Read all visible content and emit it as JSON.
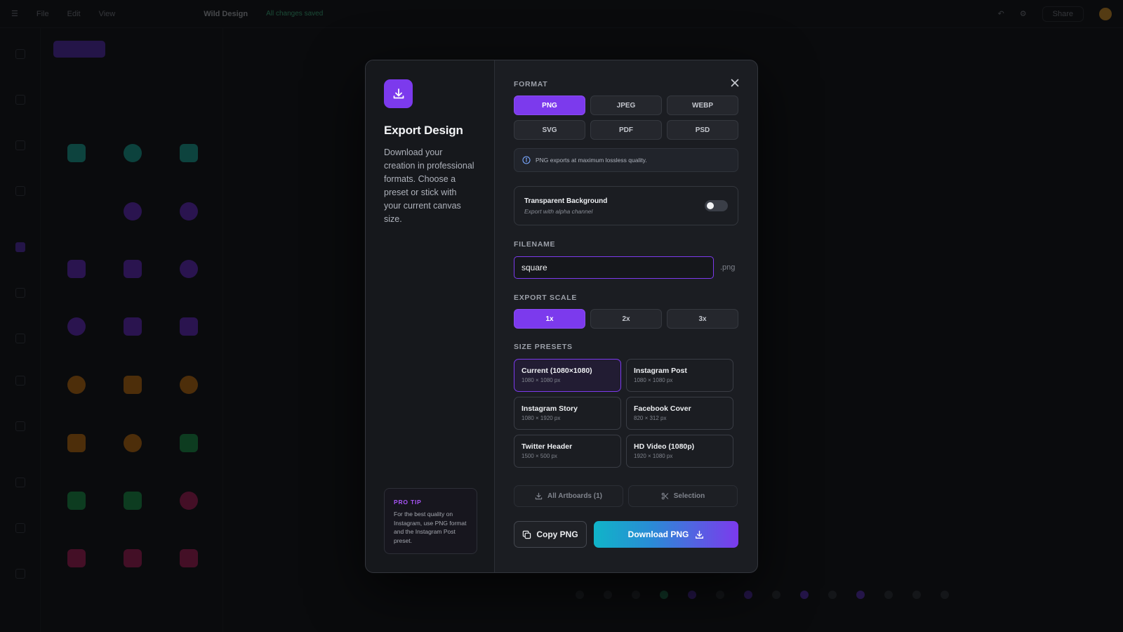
{
  "background": {
    "menu": [
      "File",
      "Edit",
      "View"
    ],
    "doc_title": "Wild Design",
    "saved_status": "All changes saved",
    "share_label": "Share"
  },
  "modal": {
    "title": "Export Design",
    "description": "Download your creation in professional formats. Choose a preset or stick with your current canvas size.",
    "pro_tip": {
      "label": "PRO TIP",
      "text": "For the best quality on Instagram, use PNG format and the Instagram Post preset."
    },
    "format": {
      "label": "FORMAT",
      "options": [
        "PNG",
        "JPEG",
        "WEBP",
        "SVG",
        "PDF",
        "PSD"
      ],
      "selected": "PNG",
      "info": "PNG exports at maximum lossless quality."
    },
    "transparent": {
      "title": "Transparent Background",
      "subtitle": "Export with alpha channel",
      "enabled": false
    },
    "filename": {
      "label": "FILENAME",
      "value": "square",
      "extension": ".png"
    },
    "scale": {
      "label": "EXPORT SCALE",
      "options": [
        "1x",
        "2x",
        "3x"
      ],
      "selected": "1x"
    },
    "presets": {
      "label": "SIZE PRESETS",
      "items": [
        {
          "name": "Current (1080×1080)",
          "size": "1080 × 1080 px",
          "selected": true
        },
        {
          "name": "Instagram Post",
          "size": "1080 × 1080 px",
          "selected": false
        },
        {
          "name": "Instagram Story",
          "size": "1080 × 1920 px",
          "selected": false
        },
        {
          "name": "Facebook Cover",
          "size": "820 × 312 px",
          "selected": false
        },
        {
          "name": "Twitter Header",
          "size": "1500 × 500 px",
          "selected": false
        },
        {
          "name": "HD Video (1080p)",
          "size": "1920 × 1080 px",
          "selected": false
        }
      ]
    },
    "buttons": {
      "all_artboards": "All Artboards (1)",
      "selection": "Selection",
      "copy": "Copy PNG",
      "download": "Download PNG"
    }
  },
  "colors": {
    "accent": "#7c3aed",
    "gradient_start": "#10b4c8",
    "gradient_end": "#7c3aed"
  }
}
